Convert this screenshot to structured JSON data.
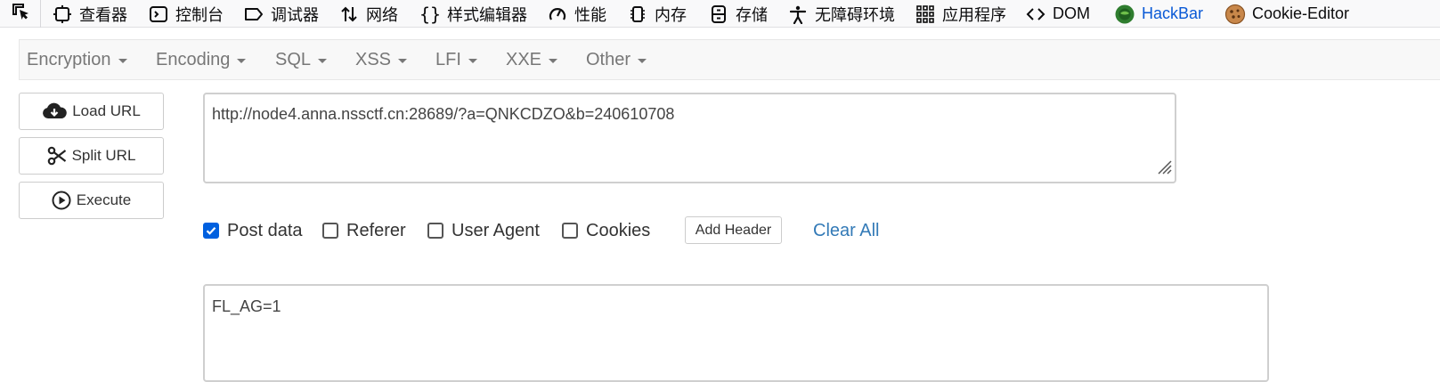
{
  "devtools": {
    "tabs": [
      {
        "label": "查看器",
        "icon": "inspector-icon"
      },
      {
        "label": "控制台",
        "icon": "console-icon"
      },
      {
        "label": "调试器",
        "icon": "debugger-icon"
      },
      {
        "label": "网络",
        "icon": "network-icon"
      },
      {
        "label": "样式编辑器",
        "icon": "style-editor-icon"
      },
      {
        "label": "性能",
        "icon": "performance-icon"
      },
      {
        "label": "内存",
        "icon": "memory-icon"
      },
      {
        "label": "存储",
        "icon": "storage-icon"
      },
      {
        "label": "无障碍环境",
        "icon": "accessibility-icon"
      },
      {
        "label": "应用程序",
        "icon": "application-icon"
      },
      {
        "label": "DOM",
        "icon": "dom-icon"
      },
      {
        "label": "HackBar",
        "icon": "hackbar-icon"
      },
      {
        "label": "Cookie-Editor",
        "icon": "cookie-icon"
      }
    ],
    "active_tab": "HackBar",
    "active_color": "#0a5ad6"
  },
  "hackbar": {
    "menus": [
      "Encryption",
      "Encoding",
      "SQL",
      "XSS",
      "LFI",
      "XXE",
      "Other"
    ],
    "buttons": {
      "load_url": "Load URL",
      "split_url": "Split URL",
      "execute": "Execute"
    },
    "url_value": "http://node4.anna.nssctf.cn:28689/?a=QNKCDZO&b=240610708",
    "options": {
      "post_data": {
        "label": "Post data",
        "checked": true
      },
      "referer": {
        "label": "Referer",
        "checked": false
      },
      "user_agent": {
        "label": "User Agent",
        "checked": false
      },
      "cookies": {
        "label": "Cookies",
        "checked": false
      }
    },
    "add_header_label": "Add Header",
    "clear_all_label": "Clear All",
    "post_data_value": "FL_AG=1",
    "colors": {
      "checkbox_checked": "#0060df",
      "link": "#337ab7"
    }
  }
}
